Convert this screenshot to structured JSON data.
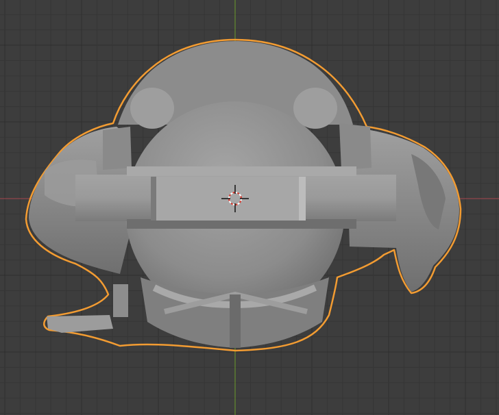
{
  "viewport": {
    "background": "#3d3d3d",
    "grid_minor_color": "#363636",
    "grid_major_color": "#2f2f2f",
    "axis_x_color": "#a8474f",
    "axis_y_color": "#6c9a2a",
    "selection_outline_color": "#f39c32",
    "mesh_color": "#8f8f8f"
  },
  "scene": {
    "object": "model-front-view",
    "selected": true,
    "cursor_icon": "3d-cursor-icon"
  }
}
